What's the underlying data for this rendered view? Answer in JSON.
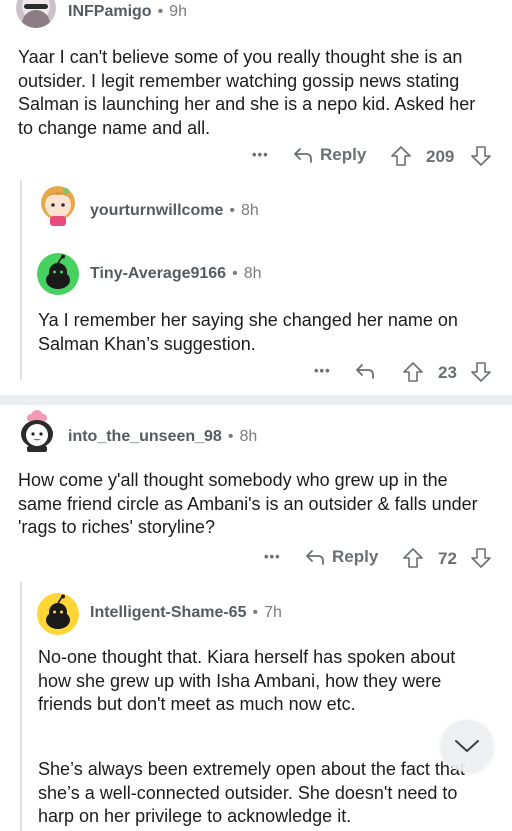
{
  "comments": [
    {
      "username": "INFPamigo",
      "time": "9h",
      "body": "Yaar I can't believe some of you really thought she is an outsider. I legit remember watching gossip news stating Salman is launching her and she is a nepo kid. Asked her to change name and all.",
      "more": "•••",
      "reply_label": "Reply",
      "score": "209"
    },
    {
      "username": "yourturnwillcome",
      "time": "8h"
    },
    {
      "username": "Tiny-Average9166",
      "time": "8h",
      "body": "Ya I remember her saying she changed her name on Salman Khan’s suggestion.",
      "more": "•••",
      "score": "23"
    },
    {
      "username": "into_the_unseen_98",
      "time": "8h",
      "body": "How come y'all thought somebody who grew up in the same friend circle as Ambani's is an outsider & falls under 'rags to riches' storyline?",
      "more": "•••",
      "reply_label": "Reply",
      "score": "72"
    },
    {
      "username": "Intelligent-Shame-65",
      "time": "7h",
      "body": "No-one thought that. Kiara herself has spoken about how she grew up with Isha Ambani, how they were friends but don't meet as much now etc.",
      "body2": "She’s always been extremely open about the fact that she’s a well-connected outsider. She doesn't need to harp on her privilege to acknowledge it."
    }
  ],
  "separator_dot": "•",
  "icons": [
    "upvote-icon",
    "downvote-icon",
    "reply-arrow-icon",
    "chevron-down-icon",
    "snoo-avatar-icon"
  ],
  "colors": {
    "text": "#1c1c1c",
    "meta": "#7c7c7c",
    "action": "#6b6f73",
    "snoo_green": "#46d160",
    "snoo_yellow": "#ffd635",
    "separator": "#eceff1"
  }
}
